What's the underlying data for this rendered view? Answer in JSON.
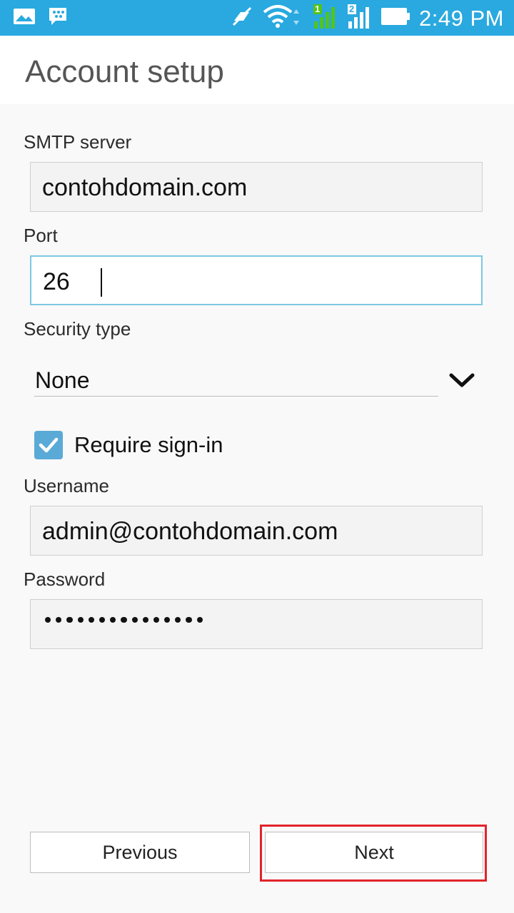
{
  "status_bar": {
    "time": "2:49 PM",
    "icons": [
      "gallery-icon",
      "bbm-icon",
      "mute-icon",
      "wifi-icon",
      "signal-sim1-icon",
      "signal-sim2-icon",
      "battery-icon"
    ],
    "sim1_label": "1",
    "sim2_label": "2",
    "color": "#29a9df"
  },
  "header": {
    "title": "Account setup"
  },
  "form": {
    "smtp_server": {
      "label": "SMTP server",
      "value": "contohdomain.com"
    },
    "port": {
      "label": "Port",
      "value": "26"
    },
    "security_type": {
      "label": "Security type",
      "value": "None"
    },
    "require_signin": {
      "label": "Require sign-in",
      "checked": true
    },
    "username": {
      "label": "Username",
      "value": "admin@contohdomain.com"
    },
    "password": {
      "label": "Password",
      "masked_length": 15
    }
  },
  "buttons": {
    "previous": "Previous",
    "next": "Next"
  },
  "colors": {
    "accent": "#5aaad7",
    "highlight": "#e1242a"
  }
}
